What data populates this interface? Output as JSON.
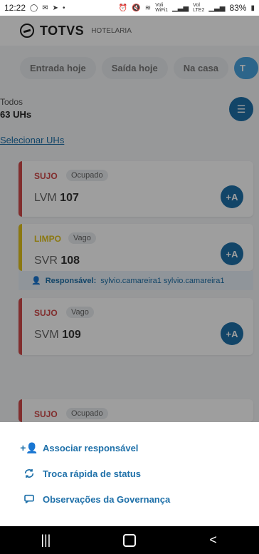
{
  "statusBar": {
    "time": "12:22",
    "battery": "83%",
    "icons": [
      "whatsapp-icon",
      "mail-icon",
      "send-icon",
      "dot-icon",
      "alarm-icon",
      "mute-icon",
      "wifi-icon",
      "volte1-icon",
      "signal1-icon",
      "volte2-icon",
      "signal2-icon",
      "battery-icon"
    ],
    "carrier1_top": "Voli",
    "carrier1_bottom": "WiFi1",
    "carrier2_top": "Vol",
    "carrier2_bottom": "LTE2"
  },
  "header": {
    "brand": "TOTVS",
    "subbrand": "HOTELARIA"
  },
  "filters": [
    {
      "label": "Entrada hoje"
    },
    {
      "label": "Saída hoje"
    },
    {
      "label": "Na casa"
    },
    {
      "label": "T"
    }
  ],
  "summary": {
    "label": "Todos",
    "count": "63 UHs"
  },
  "selectLink": "Selecionar UHs",
  "cards": [
    {
      "status": "SUJO",
      "badge": "Ocupado",
      "prefix": "LVM",
      "number": "107"
    },
    {
      "status": "LIMPO",
      "badge": "Vago",
      "prefix": "SVR",
      "number": "108"
    },
    {
      "status": "SUJO",
      "badge": "Vago",
      "prefix": "SVM",
      "number": "109"
    },
    {
      "status": "SUJO",
      "badge": "Ocupado",
      "prefix": "",
      "number": ""
    }
  ],
  "responsible": {
    "label": "Responsável:",
    "value": "sylvio.camareira1 sylvio.camareira1"
  },
  "sheet": [
    {
      "icon": "add-user-icon",
      "label": "Associar responsável"
    },
    {
      "icon": "refresh-icon",
      "label": "Troca rápida de status"
    },
    {
      "icon": "comment-icon",
      "label": "Observações da Governança"
    }
  ],
  "fabLabel": "+A",
  "navBar": {
    "recent": "|||",
    "back": "<"
  },
  "colors": {
    "primary": "#1e70a9",
    "sujo": "#d14a4a",
    "limpo": "#e0c21b",
    "overlay": "rgba(0,0,0,0.38)"
  }
}
